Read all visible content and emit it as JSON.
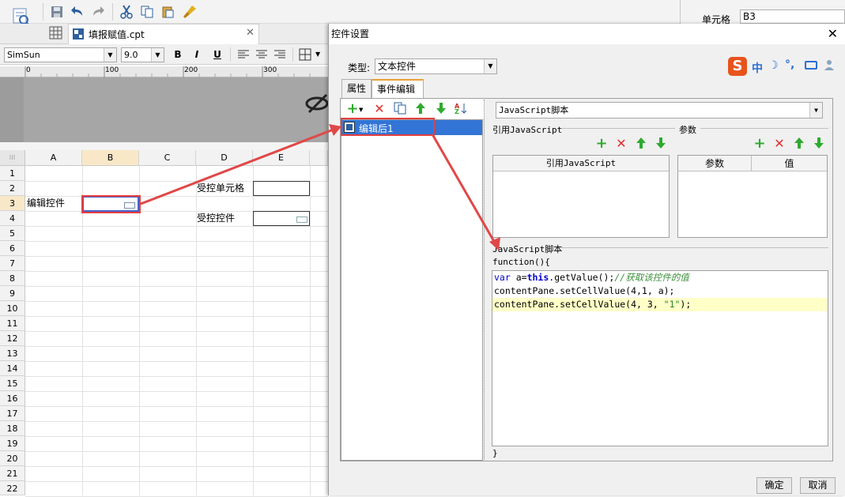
{
  "toolbar": {
    "icons": [
      "report-preview-icon",
      "save-icon",
      "undo-icon",
      "redo-icon",
      "cut-icon",
      "copy-icon",
      "paste-icon",
      "format-painter-icon"
    ]
  },
  "tab": {
    "file_name": "填报赋值.cpt"
  },
  "font": {
    "family": "SimSun",
    "size": "9.0",
    "bold": "B",
    "italic": "I",
    "underline": "U"
  },
  "ruler": {
    "marks": [
      "0",
      "100",
      "200",
      "300"
    ]
  },
  "grid": {
    "columns": [
      "A",
      "B",
      "C",
      "D",
      "E"
    ],
    "rows": [
      "1",
      "2",
      "3",
      "4",
      "5",
      "6",
      "7",
      "8",
      "9",
      "10",
      "11",
      "12",
      "13",
      "14",
      "15",
      "16",
      "17",
      "18",
      "19",
      "20",
      "21",
      "22"
    ],
    "cells": {
      "a3": "编辑控件",
      "d2": "受控单元格",
      "d4": "受控控件"
    }
  },
  "right_panel": {
    "label": "单元格",
    "value": "B3"
  },
  "dialog": {
    "title": "控件设置",
    "type_label": "类型:",
    "type_value": "文本控件",
    "ime": [
      "中",
      "°,"
    ],
    "tabs": [
      "属性",
      "事件编辑"
    ],
    "event_item": "编辑后1",
    "script_type": "JavaScript脚本",
    "ref_section": "引用JavaScript",
    "param_section": "参数",
    "ref_header": "引用JavaScript",
    "param_headers": [
      "参数",
      "值"
    ],
    "script_section": "JavaScript脚本",
    "code_open": "function(){",
    "code_lines": {
      "l1": {
        "kw1": "var",
        "t1": " a=",
        "kw2": "this",
        "t2": ".getValue();",
        "comment": "//获取该控件的值"
      },
      "l2": "contentPane.setCellValue(4,1, a);",
      "l3": {
        "t1": "contentPane.setCellValue(4, 3, ",
        "str": "\"1\"",
        "t2": ");"
      }
    },
    "code_close": "}",
    "ok": "确定",
    "cancel": "取消"
  },
  "colors": {
    "accent": "#3375d6",
    "highlight": "#ffffc8",
    "annotation": "#e53e3e",
    "keyword": "#0000c8",
    "comment": "#3a8f3a",
    "string": "#2a8a2a"
  }
}
